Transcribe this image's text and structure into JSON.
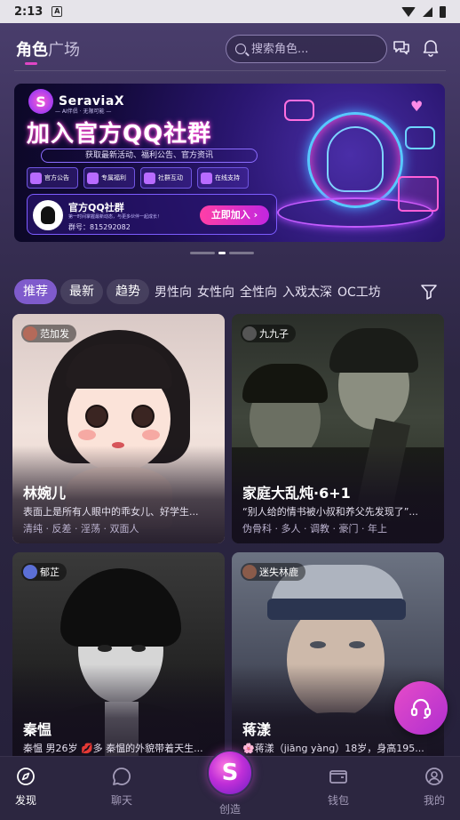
{
  "status_bar": {
    "time": "2:13",
    "notif_badge": "A"
  },
  "header": {
    "title_main": "角色",
    "title_rest": "广场",
    "search_placeholder": "搜索角色..."
  },
  "banner": {
    "brand": "SeraviaX",
    "brand_tag": "— AI伴侣 · 无限可能 —",
    "headline": "加入官方QQ社群",
    "subline": "获取最新活动、福利公告、官方资讯",
    "features": [
      "官方公告",
      "专属福利",
      "社群互动",
      "在线支持"
    ],
    "qq_title": "官方QQ社群",
    "qq_desc": "第一时间掌握最新动态，与更多伙伴一起成长！",
    "qq_number": "群号：815292082",
    "join_label": "立即加入 ›"
  },
  "tabs": {
    "pills": [
      "推荐",
      "最新",
      "趋势"
    ],
    "plain": [
      "男性向",
      "女性向",
      "全性向",
      "入戏太深",
      "OC工坊"
    ],
    "active": "推荐"
  },
  "cards": [
    {
      "creator": "范加发",
      "name": "林婉儿",
      "desc": "表面上是所有人眼中的乖女儿、好学生...",
      "tags": "清纯 · 反差 · 淫荡 · 双面人"
    },
    {
      "creator": "九九子",
      "name": "家庭大乱炖·6+1",
      "desc": "“别人给的情书被小叔和养父先发现了”...",
      "tags": "伪骨科 · 多人 · 调教 · 豪门 · 年上"
    },
    {
      "creator": "郁芷",
      "name": "秦愠",
      "desc": "秦愠 男26岁 💋多 秦愠的外貌带着天生...",
      "tags": ""
    },
    {
      "creator": "迷失林鹿",
      "name": "蒋漾",
      "desc": "🌸蒋漾（jiāng yàng）18岁，身高195...",
      "tags": ""
    }
  ],
  "nav": {
    "discover": "发现",
    "chat": "聊天",
    "create": "创造",
    "wallet": "钱包",
    "mine": "我的"
  },
  "colors": {
    "accent": "#e046c5",
    "active_tab": "#7f5bcc",
    "support_fab": "#e64cc8",
    "background": "#2a2340"
  }
}
